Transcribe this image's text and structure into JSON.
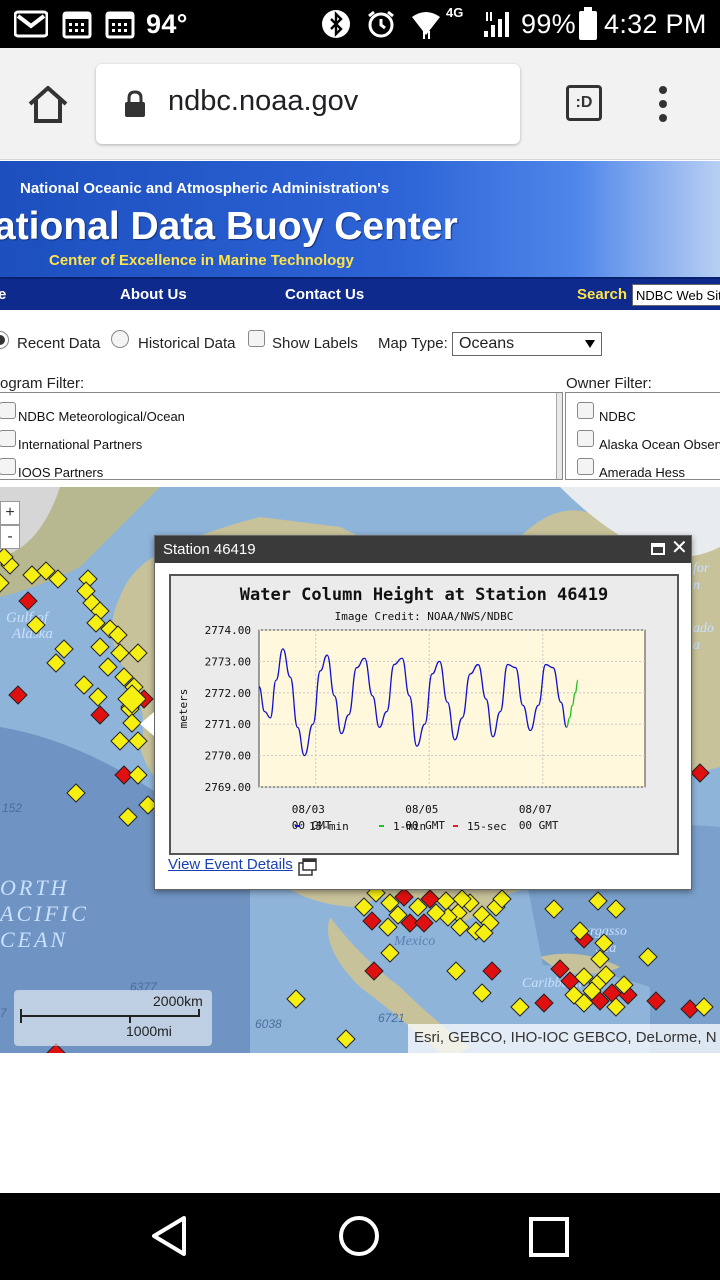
{
  "status_bar": {
    "temperature": "94°",
    "network": "4G",
    "battery": "99%",
    "time": "4:32 PM",
    "icons": [
      "gmail-icon",
      "calendar-icon",
      "calendar-icon",
      "bluetooth-icon",
      "alarm-icon",
      "wifi-icon",
      "signal-icon",
      "battery-icon"
    ]
  },
  "browser": {
    "url": "ndbc.noaa.gov",
    "tab_badge": ":D",
    "icons": [
      "home-icon",
      "lock-icon",
      "tabs-icon",
      "more-vert-icon"
    ]
  },
  "header": {
    "org": "National Oceanic and Atmospheric Administration's",
    "title": "ational Data Buoy Center",
    "subtitle": "Center of Excellence in Marine Technology",
    "nav_fragment": "e",
    "nav": [
      "About Us",
      "Contact Us"
    ],
    "search_label": "Search",
    "search_value": "NDBC Web Sit"
  },
  "controls": {
    "data_options": [
      "Recent Data",
      "Historical Data"
    ],
    "selected_data": "Recent Data",
    "show_labels": "Show Labels",
    "map_type_label": "Map Type:",
    "map_type_value": "Oceans",
    "program_filter_label": "ogram Filter:",
    "program_filters": [
      "NDBC Meteorological/Ocean",
      "International Partners",
      "IOOS Partners"
    ],
    "owner_filter_label": "Owner Filter:",
    "owner_filters": [
      "NDBC",
      "Alaska Ocean Observ",
      "Amerada Hess"
    ]
  },
  "map": {
    "labels": {
      "gulf_of_alaska_1": "Gulf of",
      "gulf_of_alaska_2": "Alaska",
      "north_pacific_1": "ORTH",
      "north_pacific_2": "ACIFIC",
      "north_pacific_3": "CEAN",
      "mexico": "Mexico",
      "sargasso": "Sargasso",
      "sargasso_2": "Sea",
      "caribbean": "Caribbean Sea",
      "depth_152": "152",
      "depth_5529": "5529",
      "depth_6377": "6377",
      "depth_6038": "6038",
      "depth_6721": "6721",
      "edge_for": "for",
      "edge_n": "n",
      "edge_ado": "ado",
      "edge_a": "a",
      "edge_7": "7"
    },
    "zoom_in": "+",
    "zoom_out": "-",
    "scale_km": "2000km",
    "scale_mi": "1000mi",
    "attribution": "Esri, GEBCO, IHO-IOC GEBCO, DeLorme, N",
    "marker_colors": {
      "active": "#f5ef12",
      "alert": "#e01010"
    }
  },
  "popup": {
    "title": "Station 46419",
    "link": "View Event Details"
  },
  "chart_data": {
    "type": "line",
    "title": "Water Column Height at Station 46419",
    "subtitle": "Image Credit: NOAA/NWS/NDBC",
    "ylabel": "meters",
    "ylim": [
      2769.0,
      2774.0
    ],
    "y_ticks": [
      "2774.00",
      "2773.00",
      "2772.00",
      "2771.00",
      "2770.00",
      "2769.00"
    ],
    "x_ticks": [
      {
        "date": "08/03",
        "time": "00 GMT"
      },
      {
        "date": "08/05",
        "time": "00 GMT"
      },
      {
        "date": "08/07",
        "time": "00 GMT"
      }
    ],
    "xlim_days": [
      2,
      8.8
    ],
    "grid": true,
    "legend": [
      {
        "name": "15-min",
        "color": "#1010d0"
      },
      {
        "name": "1-min",
        "color": "#20c020"
      },
      {
        "name": "15-sec",
        "color": "#e02020"
      }
    ],
    "series": [
      {
        "name": "15-min",
        "color": "#1010d0",
        "x": [
          2.0,
          2.1,
          2.2,
          2.3,
          2.42,
          2.55,
          2.68,
          2.8,
          2.95,
          3.08,
          3.2,
          3.33,
          3.45,
          3.58,
          3.72,
          3.86,
          4.0,
          4.12,
          4.25,
          4.38,
          4.52,
          4.65,
          4.78,
          4.92,
          5.05,
          5.18,
          5.32,
          5.45,
          5.58,
          5.72,
          5.86,
          6.0,
          6.12,
          6.25,
          6.38,
          6.52,
          6.65,
          6.78,
          6.92,
          7.05,
          7.18,
          7.32,
          7.42
        ],
        "y": [
          2772.2,
          2771.4,
          2771.2,
          2772.4,
          2773.4,
          2772.5,
          2770.9,
          2770.0,
          2771.0,
          2772.7,
          2773.2,
          2771.9,
          2770.7,
          2771.3,
          2772.8,
          2773.1,
          2771.9,
          2770.9,
          2771.4,
          2772.9,
          2773.1,
          2771.9,
          2770.3,
          2771.0,
          2772.6,
          2773.0,
          2771.7,
          2770.5,
          2771.2,
          2772.6,
          2772.9,
          2771.8,
          2770.6,
          2771.4,
          2772.9,
          2772.8,
          2771.6,
          2770.8,
          2771.6,
          2772.9,
          2772.8,
          2771.7,
          2770.9
        ]
      },
      {
        "name": "1-min",
        "color": "#20c020",
        "x": [
          7.42,
          7.47,
          7.52,
          7.57,
          7.62
        ],
        "y": [
          2770.9,
          2771.2,
          2771.6,
          2772.0,
          2772.4
        ]
      }
    ]
  }
}
